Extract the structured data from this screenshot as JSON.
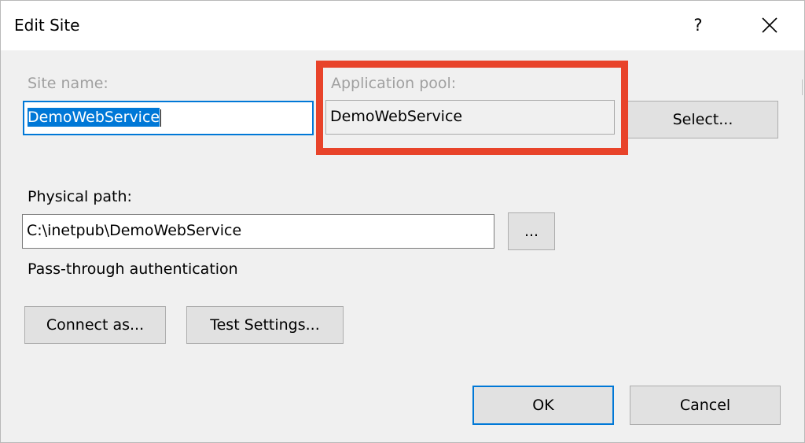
{
  "window": {
    "title": "Edit Site",
    "help_label": "?",
    "close_icon": "close-icon"
  },
  "site_name": {
    "label": "Site name:",
    "value": "DemoWebService"
  },
  "app_pool": {
    "label": "Application pool:",
    "value": "DemoWebService",
    "select_label": "Select..."
  },
  "physical_path": {
    "label": "Physical path:",
    "value": "C:\\inetpub\\DemoWebService",
    "browse_label": "..."
  },
  "auth": {
    "label": "Pass-through authentication",
    "connect_as_label": "Connect as...",
    "test_settings_label": "Test Settings..."
  },
  "footer": {
    "ok_label": "OK",
    "cancel_label": "Cancel"
  },
  "colors": {
    "accent": "#0078d7",
    "highlight": "#e8432a",
    "disabled_text": "#a0a0a0"
  }
}
